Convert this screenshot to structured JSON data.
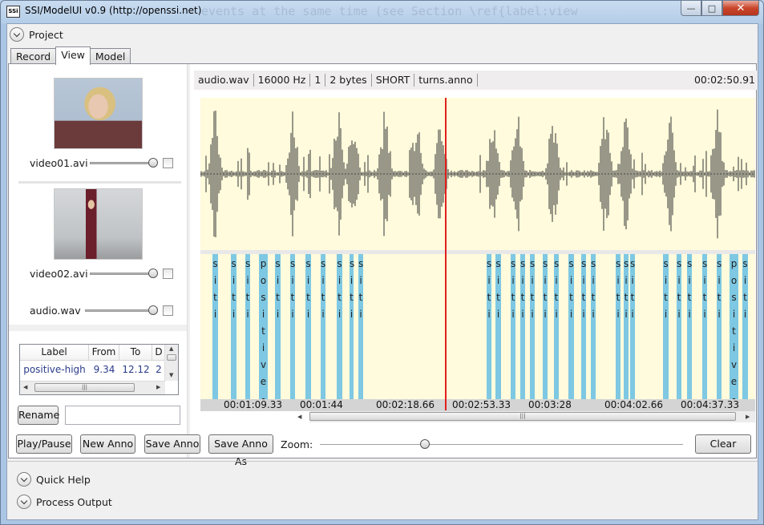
{
  "window": {
    "title": "SSI/ModelUI v0.9 (http://openssi.net)",
    "ghost_text": "events at the same time (see Section \\ref{label:view",
    "app_icon": "SSi",
    "controls": {
      "minimize": "—",
      "maximize": "□",
      "close": "✕"
    }
  },
  "project_expander": {
    "label": "Project"
  },
  "tabs": [
    {
      "label": "Record",
      "active": false
    },
    {
      "label": "View",
      "active": true
    },
    {
      "label": "Model",
      "active": false
    }
  ],
  "media": [
    {
      "label": "video01.avi",
      "level": 1.0,
      "checked": false
    },
    {
      "label": "video02.avi",
      "level": 1.0,
      "checked": false
    },
    {
      "label": "audio.wav",
      "level": 1.0,
      "checked": false
    }
  ],
  "anno_table": {
    "columns": [
      "Label",
      "From",
      "To",
      "D"
    ],
    "rows": [
      {
        "label": "positive-high",
        "from": "9.34",
        "to": "12.12",
        "d": "2"
      }
    ]
  },
  "rename": {
    "button": "Rename",
    "value": ""
  },
  "viewer": {
    "info": [
      "audio.wav",
      "16000 Hz",
      "1",
      "2 bytes",
      "SHORT",
      "turns.anno"
    ],
    "duration": "00:02:50.91",
    "timeline": [
      "00:01:09.33",
      "00:01:44",
      "00:02:18.66",
      "00:02:53.33",
      "00:03:28",
      "00:04:02.66",
      "00:04:37.33"
    ],
    "anno_text_short": [
      "s",
      "i",
      "t",
      "i"
    ],
    "anno_text_long": [
      "p",
      "o",
      "s",
      "i",
      "t",
      "i",
      "v",
      "e",
      "-"
    ],
    "colors": {
      "background": "#fffbdc",
      "wave": "#333333",
      "anno": "#7ec8e3",
      "cursor": "#e0201e"
    }
  },
  "buttons": {
    "play_pause": "Play/Pause",
    "new_anno": "New Anno",
    "save_anno": "Save Anno",
    "save_anno_as": "Save Anno As",
    "clear": "Clear"
  },
  "zoom": {
    "label": "Zoom:",
    "level": 0.29
  },
  "footer": {
    "quick_help": "Quick Help",
    "process_output": "Process Output"
  }
}
